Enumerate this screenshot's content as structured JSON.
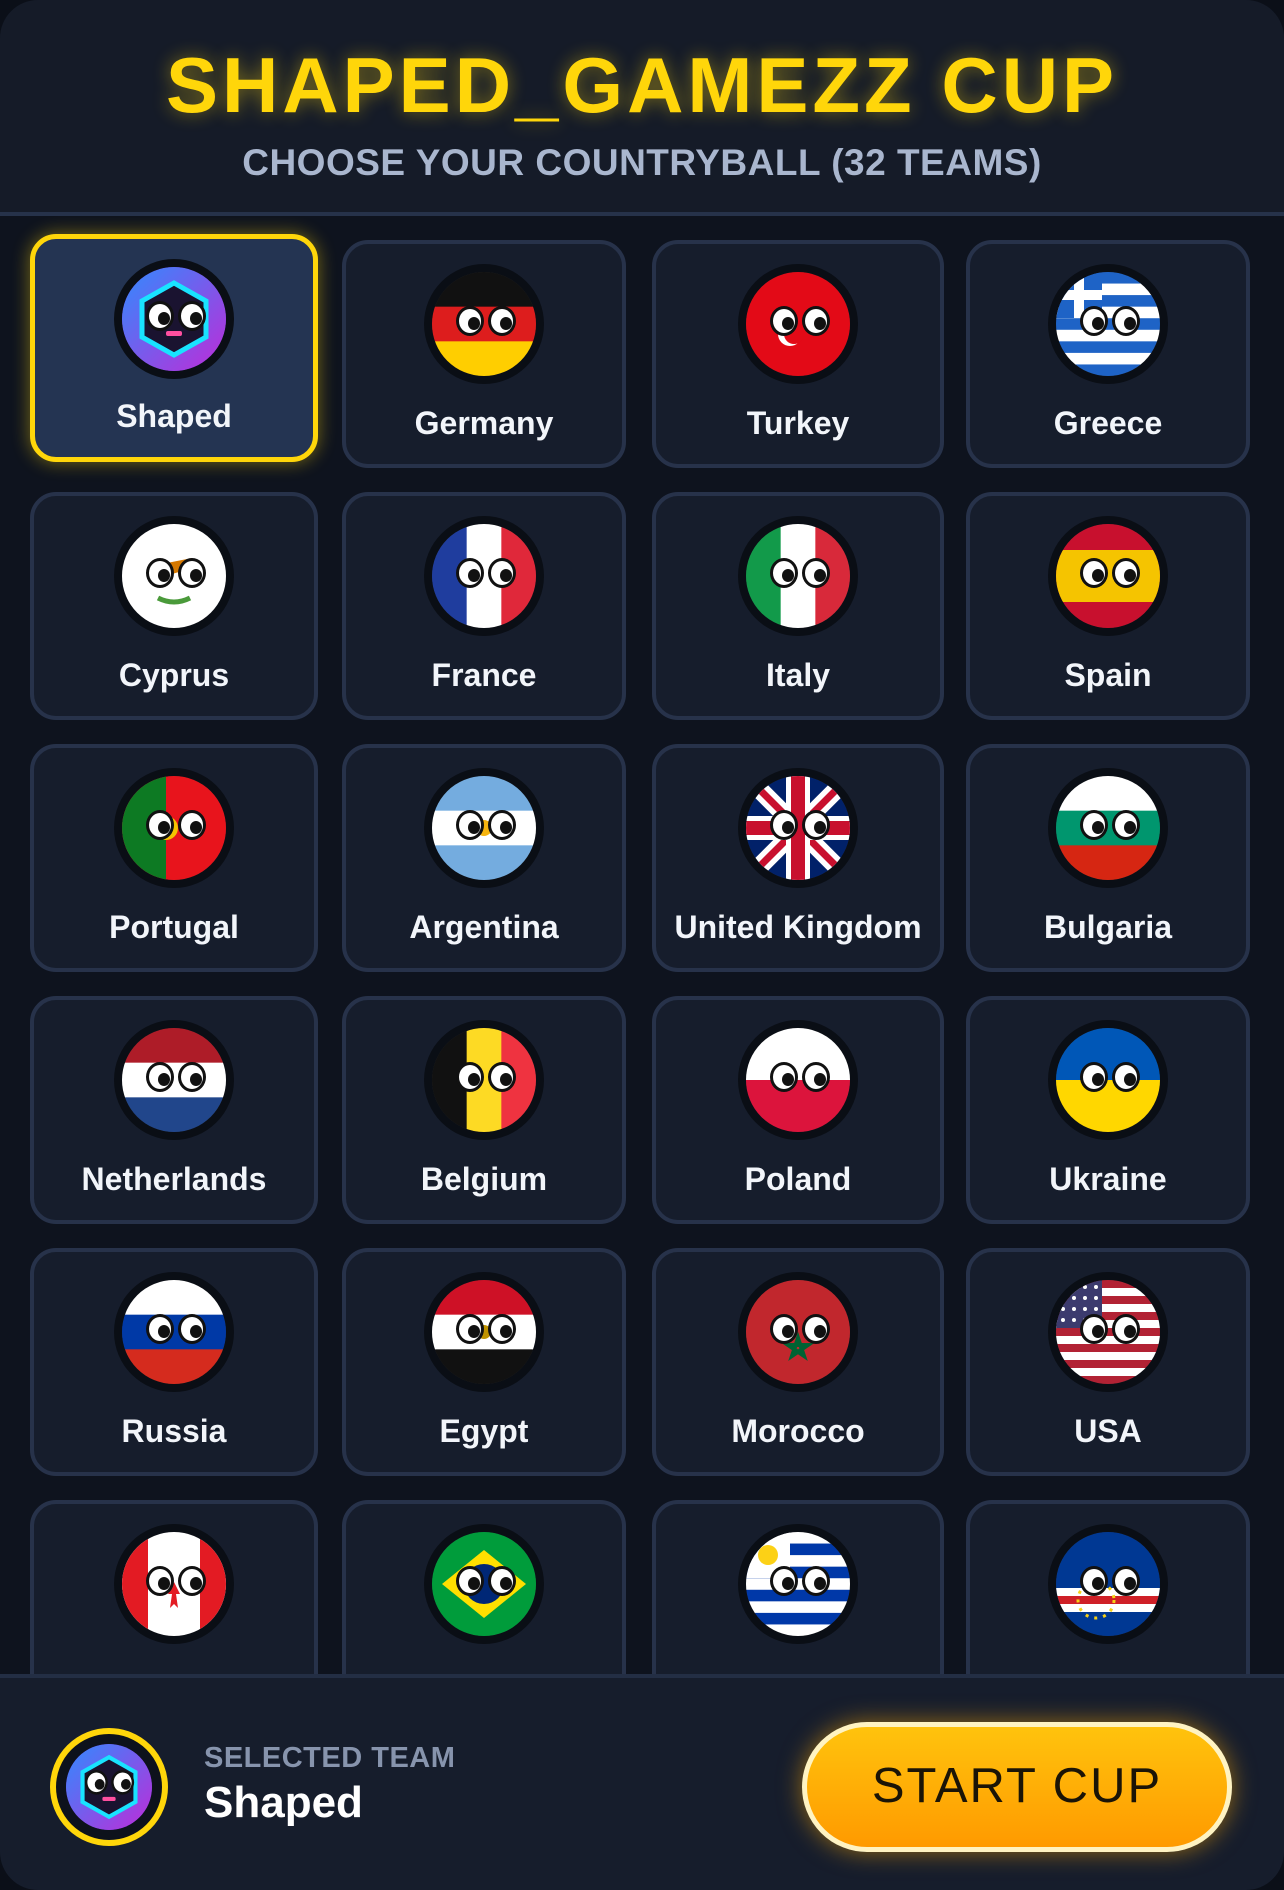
{
  "header": {
    "title": "SHAPED_GAMEZZ CUP",
    "subtitle": "CHOOSE YOUR COUNTRYBALL (32 TEAMS)"
  },
  "teams": [
    {
      "name": "Shaped",
      "flag": "shaped",
      "selected": true
    },
    {
      "name": "Germany",
      "flag": "germany"
    },
    {
      "name": "Turkey",
      "flag": "turkey"
    },
    {
      "name": "Greece",
      "flag": "greece"
    },
    {
      "name": "Cyprus",
      "flag": "cyprus"
    },
    {
      "name": "France",
      "flag": "france"
    },
    {
      "name": "Italy",
      "flag": "italy"
    },
    {
      "name": "Spain",
      "flag": "spain"
    },
    {
      "name": "Portugal",
      "flag": "portugal"
    },
    {
      "name": "Argentina",
      "flag": "argentina"
    },
    {
      "name": "United Kingdom",
      "flag": "uk"
    },
    {
      "name": "Bulgaria",
      "flag": "bulgaria"
    },
    {
      "name": "Netherlands",
      "flag": "netherlands"
    },
    {
      "name": "Belgium",
      "flag": "belgium"
    },
    {
      "name": "Poland",
      "flag": "poland"
    },
    {
      "name": "Ukraine",
      "flag": "ukraine"
    },
    {
      "name": "Russia",
      "flag": "russia"
    },
    {
      "name": "Egypt",
      "flag": "egypt"
    },
    {
      "name": "Morocco",
      "flag": "morocco"
    },
    {
      "name": "USA",
      "flag": "usa"
    },
    {
      "name": "",
      "flag": "canada"
    },
    {
      "name": "",
      "flag": "brazil"
    },
    {
      "name": "",
      "flag": "uruguay"
    },
    {
      "name": "",
      "flag": "cape-verde"
    }
  ],
  "footer": {
    "selected_label": "SELECTED TEAM",
    "selected_name": "Shaped",
    "start_label": "START CUP"
  },
  "colors": {
    "accent": "#ffd60a",
    "button": "#ffa500",
    "card_bg": "#161d2c",
    "selected_card_bg": "#243452"
  }
}
